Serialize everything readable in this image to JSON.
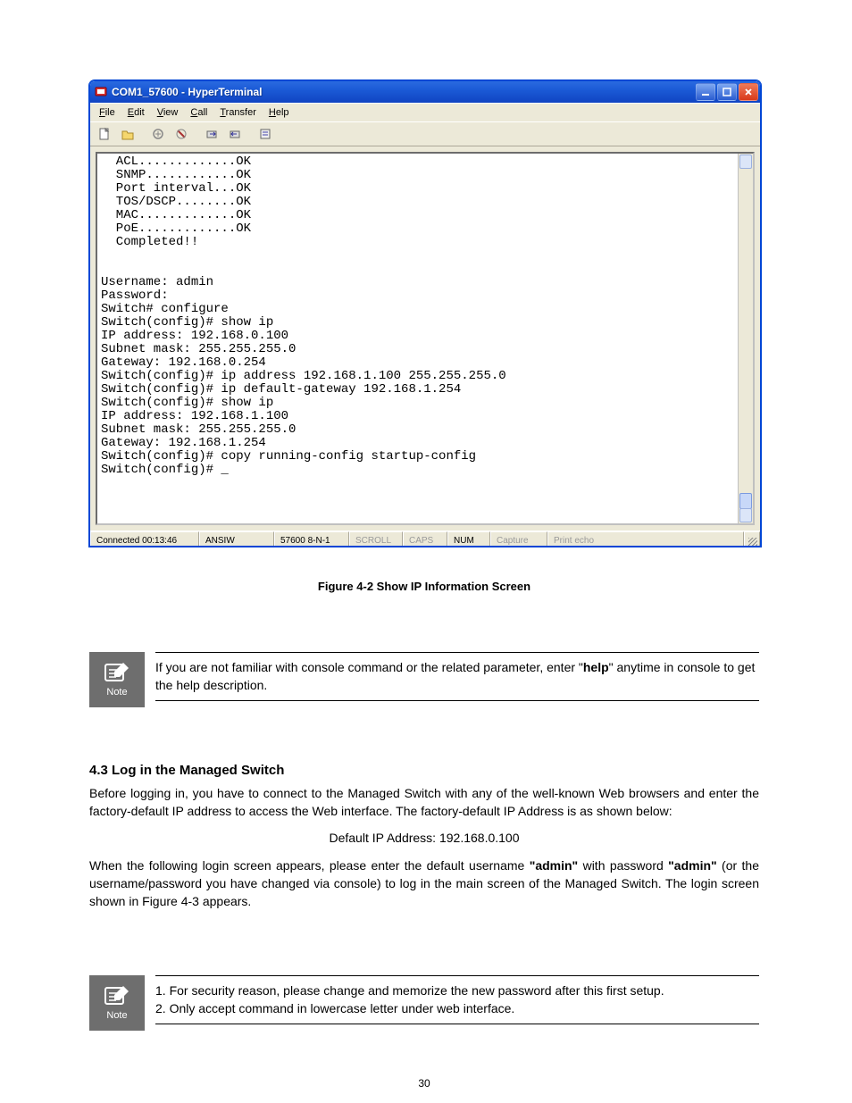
{
  "window": {
    "title": "COM1_57600 - HyperTerminal",
    "menus": {
      "file": "File",
      "edit": "Edit",
      "view": "View",
      "call": "Call",
      "transfer": "Transfer",
      "help": "Help"
    }
  },
  "terminal": {
    "content": "  ACL.............OK\n  SNMP............OK\n  Port interval...OK\n  TOS/DSCP........OK\n  MAC.............OK\n  PoE.............OK\n  Completed!!\n\n\nUsername: admin\nPassword:\nSwitch# configure\nSwitch(config)# show ip\nIP address: 192.168.0.100\nSubnet mask: 255.255.255.0\nGateway: 192.168.0.254\nSwitch(config)# ip address 192.168.1.100 255.255.255.0\nSwitch(config)# ip default-gateway 192.168.1.254\nSwitch(config)# show ip\nIP address: 192.168.1.100\nSubnet mask: 255.255.255.0\nGateway: 192.168.1.254\nSwitch(config)# copy running-config startup-config\nSwitch(config)# _"
  },
  "status": {
    "connected": "Connected 00:13:46",
    "emulation": "ANSIW",
    "settings": "57600 8-N-1",
    "scroll": "SCROLL",
    "caps": "CAPS",
    "num": "NUM",
    "capture": "Capture",
    "printecho": "Print echo"
  },
  "doc": {
    "fig_caption": "Figure 4-2 Show IP Information Screen",
    "note1": "If you are not familiar with console command or the related parameter, enter \"help\" anytime in console to get the help description.",
    "login_heading": "4.3 Log in the Managed Switch",
    "login_p": "Before logging in, you have to connect to the Managed Switch with any of the well-known Web browsers and enter the factory-default IP address to access the Web interface. The factory-default IP Address is as shown below:",
    "login_ip": "Default IP Address: 192.168.0.100",
    "login_p2": "When the following login screen appears, please enter the default username \"admin\" with password \"admin\" (or the username/password you have changed via console) to log in the main screen of the Managed Switch. The login screen shown in Figure 4-3 appears.",
    "note2_l1": "1. For security reason, please change and memorize the new password after this first setup.",
    "note2_l2": "2. Only accept command in lowercase letter under web interface.",
    "note_label": "Note",
    "page_no": "30"
  }
}
